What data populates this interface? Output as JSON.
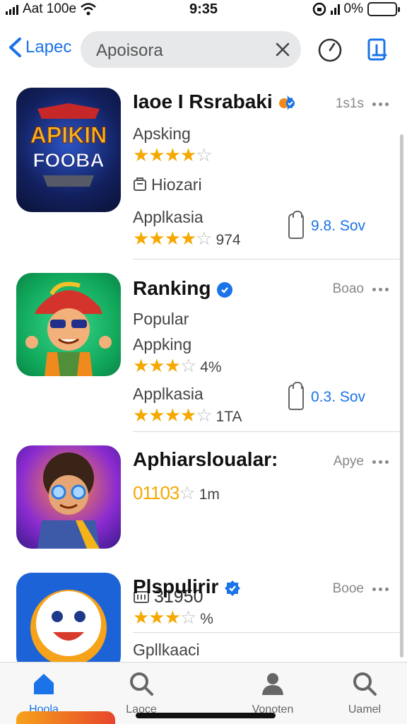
{
  "status_bar": {
    "carrier": "Aat 100e",
    "time": "9:35",
    "battery": "0%"
  },
  "header": {
    "back_label": "Lapec",
    "search_query": "Apoisora"
  },
  "results": [
    {
      "title": "Iaoe I Rsrabaki",
      "meta": "1s1s",
      "icon": "apkin-fooba-game-icon",
      "icon_text_top": "APIKIN",
      "icon_text_bottom": "FOOBA",
      "subtitle": "Apsking",
      "stars1": 4,
      "tag_icon": "bag-icon",
      "tag": "Hiozari",
      "line2": "Applkasia",
      "stars2": 4,
      "count2": "974",
      "size": "9.8. Sov"
    },
    {
      "title": "Ranking",
      "meta": "Boao",
      "icon": "cartoon-boy-icon",
      "subtitle": "Popular",
      "line1b": "Appking",
      "stars1": 3,
      "count1": "4%",
      "line2": "Applkasia",
      "stars2": 4,
      "count2": "1TA",
      "size": "0.3. Sov"
    },
    {
      "title": "Aphiarsloualar:",
      "meta": "Apye",
      "icon": "cartoon-man-icon",
      "rating_text": "01103",
      "stars1": 1,
      "count1": "1m",
      "tag_icon": "building-icon",
      "tag": "31950"
    },
    {
      "title": "Plspulirir",
      "meta": "Booe",
      "icon": "smiley-icon",
      "stars1": 3,
      "count1": "%",
      "line2": "Gpllkaaci"
    }
  ],
  "tabbar": {
    "tabs": [
      {
        "label": "Hoola",
        "icon": "home-icon"
      },
      {
        "label": "Laoce",
        "icon": "search-icon"
      },
      {
        "label": "Vonoten",
        "icon": "person-icon"
      },
      {
        "label": "Uamel",
        "icon": "search-icon"
      }
    ]
  },
  "colors": {
    "accent": "#1a73e8",
    "star": "#f5a800",
    "battery": "#3ccb3c"
  }
}
